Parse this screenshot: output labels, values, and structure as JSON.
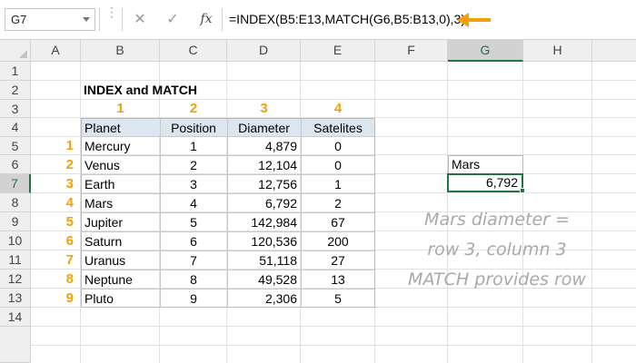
{
  "formula_bar": {
    "name_box": "G7",
    "cancel_icon": "✕",
    "enter_icon": "✓",
    "fx_label": "fx",
    "formula": "=INDEX(B5:E13,MATCH(G6,B5:B13,0),3)"
  },
  "columns": [
    "A",
    "B",
    "C",
    "D",
    "E",
    "F",
    "G",
    "H"
  ],
  "selected_column": "G",
  "rows": [
    "1",
    "2",
    "3",
    "4",
    "5",
    "6",
    "7",
    "8",
    "9",
    "10",
    "11",
    "12",
    "13",
    "14"
  ],
  "selected_row": "7",
  "sheet": {
    "title": "INDEX and MATCH",
    "column_numbers": [
      "1",
      "2",
      "3",
      "4"
    ],
    "headers": [
      "Planet",
      "Position",
      "Diameter",
      "Satelites"
    ],
    "row_numbers": [
      "1",
      "2",
      "3",
      "4",
      "5",
      "6",
      "7",
      "8",
      "9"
    ],
    "planets": [
      {
        "name": "Mercury",
        "position": "1",
        "diameter": "4,879",
        "satellites": "0"
      },
      {
        "name": "Venus",
        "position": "2",
        "diameter": "12,104",
        "satellites": "0"
      },
      {
        "name": "Earth",
        "position": "3",
        "diameter": "12,756",
        "satellites": "1"
      },
      {
        "name": "Mars",
        "position": "4",
        "diameter": "6,792",
        "satellites": "2"
      },
      {
        "name": "Jupiter",
        "position": "5",
        "diameter": "142,984",
        "satellites": "67"
      },
      {
        "name": "Saturn",
        "position": "6",
        "diameter": "120,536",
        "satellites": "200"
      },
      {
        "name": "Uranus",
        "position": "7",
        "diameter": "51,118",
        "satellites": "27"
      },
      {
        "name": "Neptune",
        "position": "8",
        "diameter": "49,528",
        "satellites": "13"
      },
      {
        "name": "Pluto",
        "position": "9",
        "diameter": "2,306",
        "satellites": "5"
      }
    ],
    "lookup_value": "Mars",
    "result": "6,792"
  },
  "annotation": [
    "Mars diameter =",
    "row 3, column 3",
    "MATCH provides row"
  ],
  "colors": {
    "accent_orange": "#f2a007",
    "excel_green": "#217346",
    "table_header": "#dce6f1",
    "annotation_gray": "#a9a9a9"
  }
}
